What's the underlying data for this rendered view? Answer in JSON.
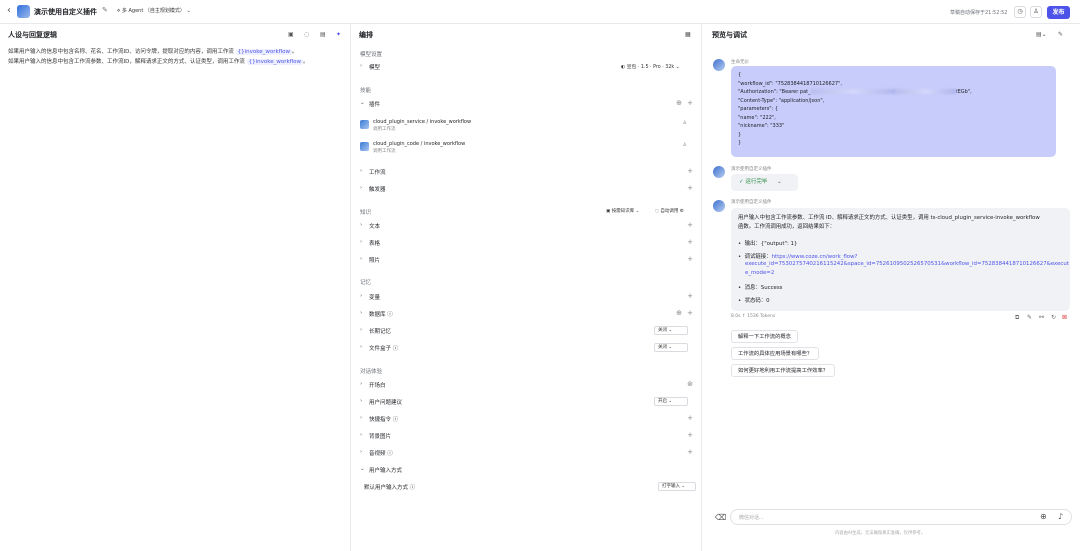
{
  "header": {
    "back_icon": "chevron-left-icon",
    "title": "演示使用自定义插件",
    "mode": "多 Agent （自主规划模式）",
    "saved": "草稿自动保存于21:52:52",
    "publish": "发布"
  },
  "persona": {
    "title": "人设与回复逻辑",
    "lines": [
      {
        "pre": "如果用户输入的信息中包含名称、花名、工作流ID、访问令牌，提取对应的内容，调用工作流 ",
        "chip": "{}invoke_workflow",
        "post": "。"
      },
      {
        "pre": "如果用户输入的信息中包含工作流参数、工作流ID，解释请求正文的方式、认证类型，调用工作流 ",
        "chip": "{}invoke_workflow",
        "post": "。"
      }
    ]
  },
  "orchestration": {
    "title": "编排",
    "model_settings": "模型设置",
    "model_row": "模型",
    "model_chip": "豆包 · 1.5 · Pro · 32k",
    "skills_label": "技能",
    "plugins": "插件",
    "plugin_items": [
      {
        "name": "cloud_plugin_service / invoke_workflow",
        "desc": "调用工作流"
      },
      {
        "name": "cloud_plugin_code / invoke_workflow",
        "desc": "调用工作流"
      }
    ],
    "workflow": "工作流",
    "trigger": "触发器",
    "knowledge_label": "知识",
    "kb_opt1": "按需知识库",
    "kb_opt2": "自动调用",
    "text": "文本",
    "table": "表格",
    "photo": "照片",
    "memory_label": "记忆",
    "variables": "变量",
    "database": "数据库",
    "long_memory": "长期记忆",
    "long_memory_value": "关闭",
    "file_box": "文件盒子",
    "file_box_value": "关闭",
    "dialog_label": "对话体验",
    "opening": "开场白",
    "suggest": "用户问题建议",
    "suggest_value": "开启",
    "shortcut": "快捷指令",
    "background": "背景图片",
    "video": "音视频",
    "input_mode": "用户输入方式",
    "default_input": "默认用户输入方式",
    "default_input_value": "打字输入"
  },
  "preview": {
    "title": "预览与调试",
    "user_name": "生命无价",
    "json_lines": [
      "{",
      "\"workflow_id\": \"7528384418710126627\",",
      "\"Authorization\": \"Bearer pat_",
      "\"Content-Type\": \"application/json\",",
      "\"parameters\": {",
      "\"name\": \"222\",",
      "\"nickname\": \"333\"",
      "}",
      "}"
    ],
    "auth_tail": "tEGb\",",
    "bot_name": "演示使用自定义插件",
    "run_done": "运行完毕",
    "reply_intro1": "用户输入中包含工作流参数、工作流 ID、解释请求正文的方式、认证类型，调用 ts-cloud_plugin_service-invoke_workflow",
    "reply_intro2": "函数。工作流调用成功，返回结果如下：",
    "b1_label": "输出：",
    "b1_value": "{\"output\": 1}",
    "b2_label": "调试链接：",
    "b2_link1": "https://www.coze.cn/work_flow?",
    "b2_link2": "execute_id=7530275740216115242&space_id=7526109502526570531&workflow_id=7528384418710126627&execut",
    "b2_link3": "e_mode=2",
    "b3": "消息：Success",
    "b4": "状态码：0",
    "meta": "8.0s  ↑  1536 Tokens",
    "suggestions": [
      "解释一下工作流的概念",
      "工作流的具体应用场景有哪些？",
      "如何更好地利用工作流提高工作效率？"
    ],
    "input_placeholder": "微信对话...",
    "disclaimer": "内容由AI生成，无法确保真实准确，仅供参考。"
  }
}
